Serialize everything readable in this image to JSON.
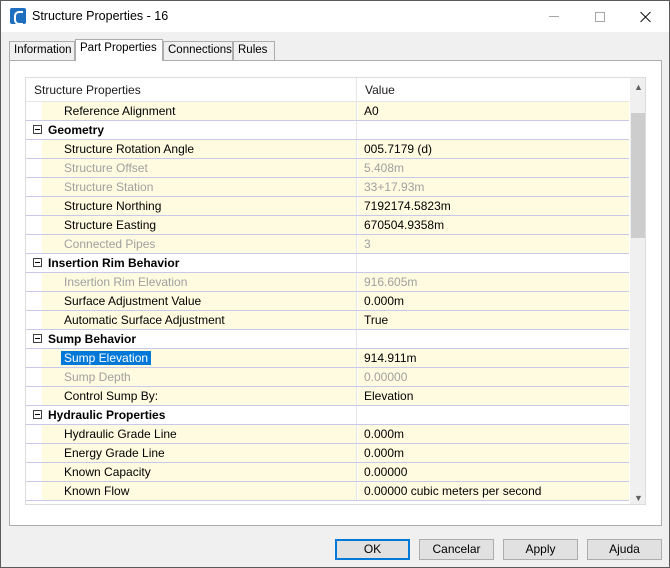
{
  "window": {
    "title": "Structure Properties - 16",
    "icons": {
      "app": "civil3d-app-icon",
      "minimize": "minimize-icon",
      "maximize": "maximize-icon",
      "close": "close-icon"
    }
  },
  "tabs": [
    {
      "label": "Information"
    },
    {
      "label": "Part Properties",
      "active": true
    },
    {
      "label": "Connections"
    },
    {
      "label": "Rules"
    }
  ],
  "grid": {
    "headers": {
      "property": "Structure Properties",
      "value": "Value"
    },
    "rows": [
      {
        "type": "prop",
        "label": "Reference Alignment",
        "value": "A0"
      },
      {
        "type": "cat",
        "label": "Geometry"
      },
      {
        "type": "prop",
        "label": "Structure Rotation Angle",
        "value": "005.7179 (d)"
      },
      {
        "type": "prop",
        "label": "Structure Offset",
        "value": "5.408m",
        "disabled": true
      },
      {
        "type": "prop",
        "label": "Structure Station",
        "value": "33+17.93m",
        "disabled": true
      },
      {
        "type": "prop",
        "label": "Structure Northing",
        "value": "7192174.5823m"
      },
      {
        "type": "prop",
        "label": "Structure Easting",
        "value": "670504.9358m"
      },
      {
        "type": "prop",
        "label": "Connected Pipes",
        "value": "3",
        "disabled": true
      },
      {
        "type": "cat",
        "label": "Insertion Rim Behavior"
      },
      {
        "type": "prop",
        "label": "Insertion Rim Elevation",
        "value": "916.605m",
        "disabled": true
      },
      {
        "type": "prop",
        "label": "Surface Adjustment Value",
        "value": "0.000m"
      },
      {
        "type": "prop",
        "label": "Automatic Surface Adjustment",
        "value": "True"
      },
      {
        "type": "cat",
        "label": "Sump Behavior"
      },
      {
        "type": "prop",
        "label": "Sump Elevation",
        "value": "914.911m",
        "selected": true
      },
      {
        "type": "prop",
        "label": "Sump Depth",
        "value": "0.00000",
        "disabled": true
      },
      {
        "type": "prop",
        "label": "Control Sump By:",
        "value": "Elevation"
      },
      {
        "type": "cat",
        "label": "Hydraulic Properties"
      },
      {
        "type": "prop",
        "label": "Hydraulic Grade Line",
        "value": "0.000m"
      },
      {
        "type": "prop",
        "label": "Energy Grade Line",
        "value": "0.000m"
      },
      {
        "type": "prop",
        "label": "Known Capacity",
        "value": "0.00000"
      },
      {
        "type": "prop",
        "label": "Known Flow",
        "value": "0.00000 cubic meters per second"
      }
    ]
  },
  "buttons": {
    "ok": "OK",
    "cancel": "Cancelar",
    "apply": "Apply",
    "help": "Ajuda"
  }
}
